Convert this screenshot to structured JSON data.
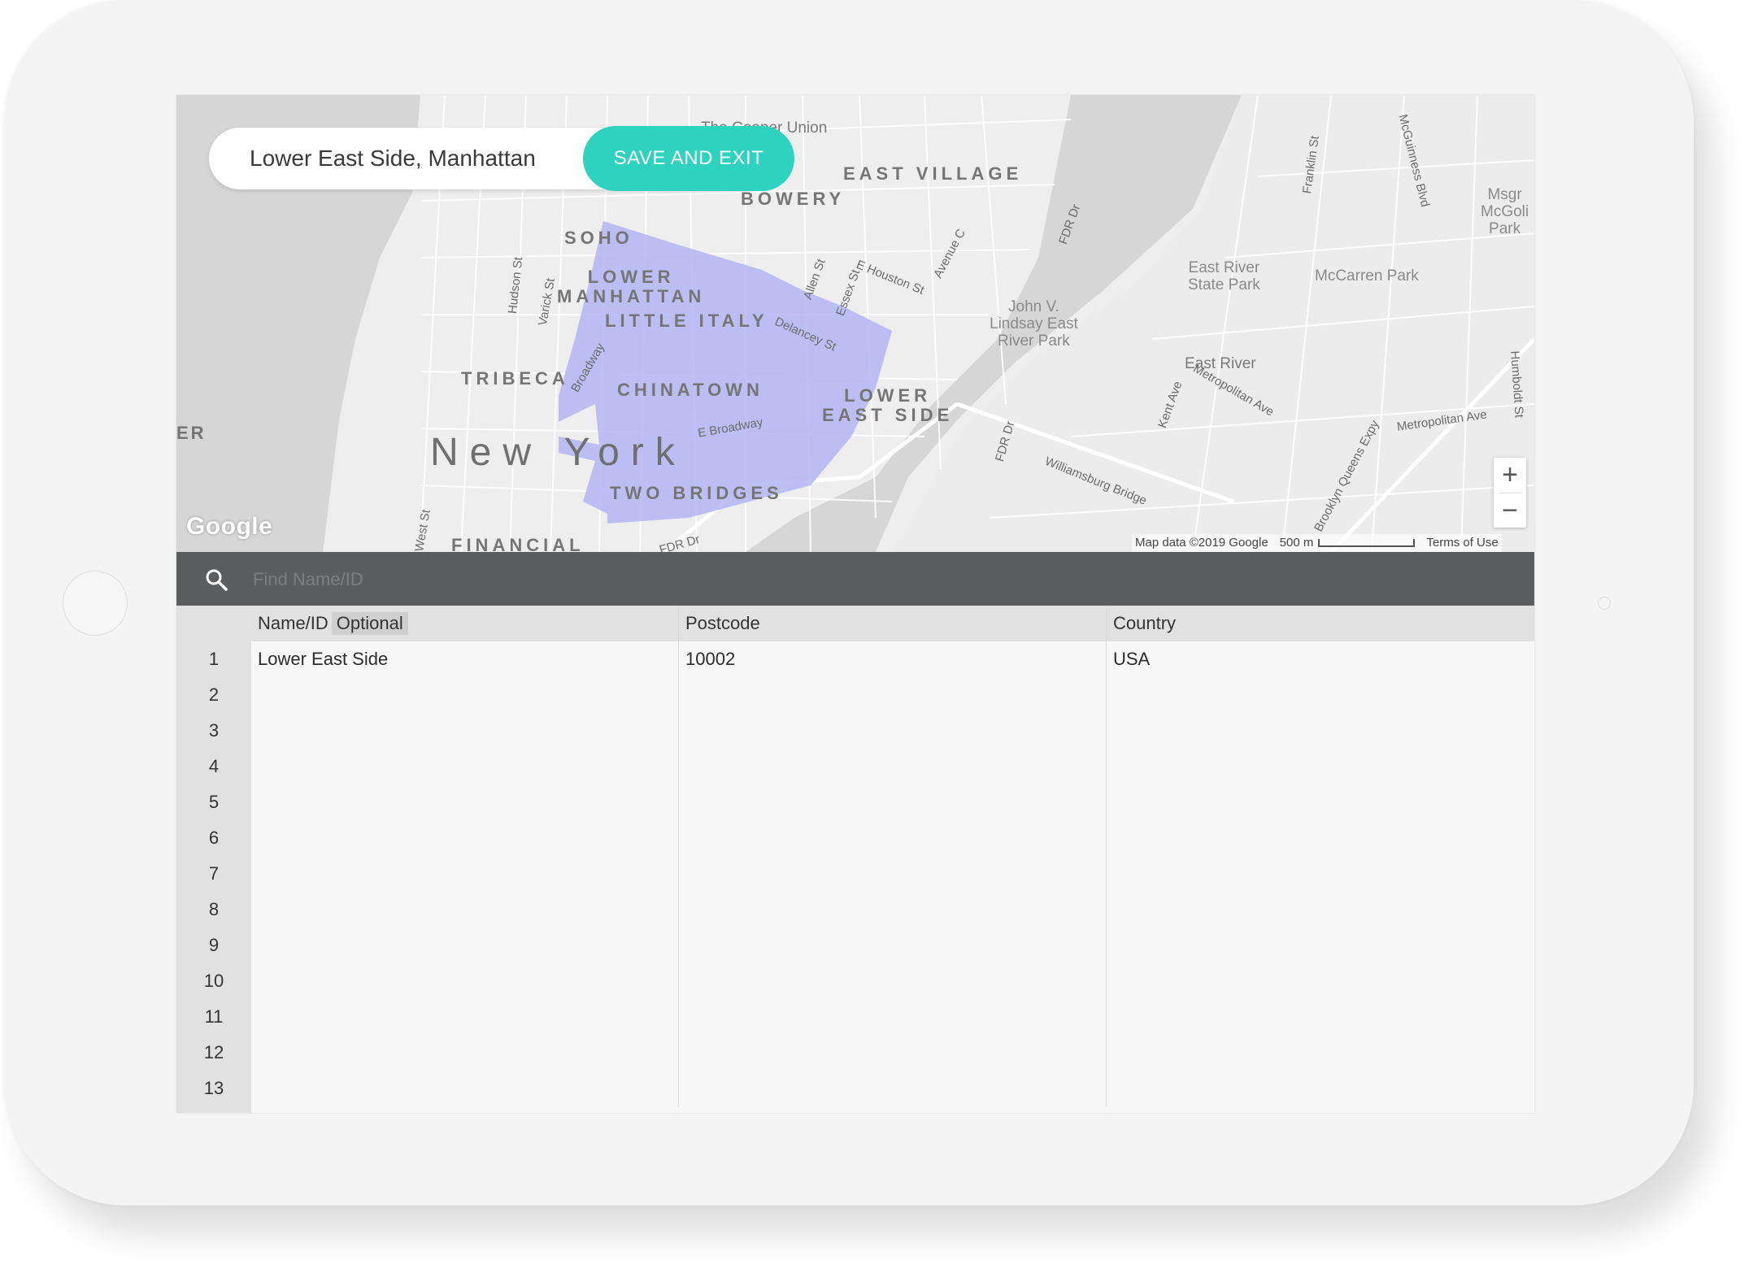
{
  "header": {
    "location_title": "Lower East Side, Manhattan",
    "save_label": "SAVE AND EXIT"
  },
  "map": {
    "labels": {
      "east_village": "EAST VILLAGE",
      "bowery": "BOWERY",
      "soho": "SOHO",
      "lower_manhattan": "LOWER\nMANHATTAN",
      "little_italy": "LITTLE ITALY",
      "tribeca": "TRIBECA",
      "chinatown": "CHINATOWN",
      "lower_east_side": "LOWER\nEAST SIDE",
      "new_york": "New York",
      "two_bridges": "TWO BRIDGES",
      "financial": "FINANCIAL",
      "cooper_union": "The Cooper Union",
      "east_river_park": "East River\nState Park",
      "mccarren_park": "McCarren Park",
      "lindsay_park": "John V.\nLindsay East\nRiver Park",
      "msgr_park": "Msgr\nMcGoli\nPark",
      "williamsburg_bridge": "Williamsburg Bridge",
      "metropolitan_ave_1": "Metropolitan Ave",
      "metropolitan_ave_2": "Metropolitan Ave",
      "e_broadway": "E Broadway",
      "delancey": "Delancey St",
      "e_houston": "E Houston St",
      "allen": "Allen St",
      "essex": "Essex St",
      "avenue_c": "Avenue C",
      "fdr_dr_1": "FDR Dr",
      "fdr_dr_2": "FDR Dr",
      "fdr_dr_3": "FDR Dr",
      "hudson": "Hudson St",
      "varick": "Varick St",
      "broadway": "Broadway",
      "kent": "Kent Ave",
      "bqe": "Brooklyn Queens Expy",
      "east_river": "East River",
      "franklin": "Franklin St",
      "mcguinness": "McGuinness Blvd",
      "humboldt": "Humboldt St",
      "west_st": "West St",
      "er_edge": "ER"
    },
    "google_logo": "Google",
    "map_data": "Map data ©2019 Google",
    "scale": "500 m",
    "terms": "Terms of Use",
    "zoom_in": "+",
    "zoom_out": "−",
    "region_color": "#b3b5f3"
  },
  "search": {
    "placeholder": "Find Name/ID"
  },
  "table": {
    "columns": [
      "Name/ID",
      "Postcode",
      "Country"
    ],
    "optional_tag": "Optional",
    "rows": [
      {
        "num": "1",
        "name": "Lower East Side",
        "postcode": "10002",
        "country": "USA"
      },
      {
        "num": "2",
        "name": "",
        "postcode": "",
        "country": ""
      },
      {
        "num": "3",
        "name": "",
        "postcode": "",
        "country": ""
      },
      {
        "num": "4",
        "name": "",
        "postcode": "",
        "country": ""
      },
      {
        "num": "5",
        "name": "",
        "postcode": "",
        "country": ""
      },
      {
        "num": "6",
        "name": "",
        "postcode": "",
        "country": ""
      },
      {
        "num": "7",
        "name": "",
        "postcode": "",
        "country": ""
      },
      {
        "num": "8",
        "name": "",
        "postcode": "",
        "country": ""
      },
      {
        "num": "9",
        "name": "",
        "postcode": "",
        "country": ""
      },
      {
        "num": "10",
        "name": "",
        "postcode": "",
        "country": ""
      },
      {
        "num": "11",
        "name": "",
        "postcode": "",
        "country": ""
      },
      {
        "num": "12",
        "name": "",
        "postcode": "",
        "country": ""
      },
      {
        "num": "13",
        "name": "",
        "postcode": "",
        "country": ""
      }
    ]
  },
  "colors": {
    "accent": "#2ed3bf",
    "search_bar": "#5c5d5f"
  }
}
